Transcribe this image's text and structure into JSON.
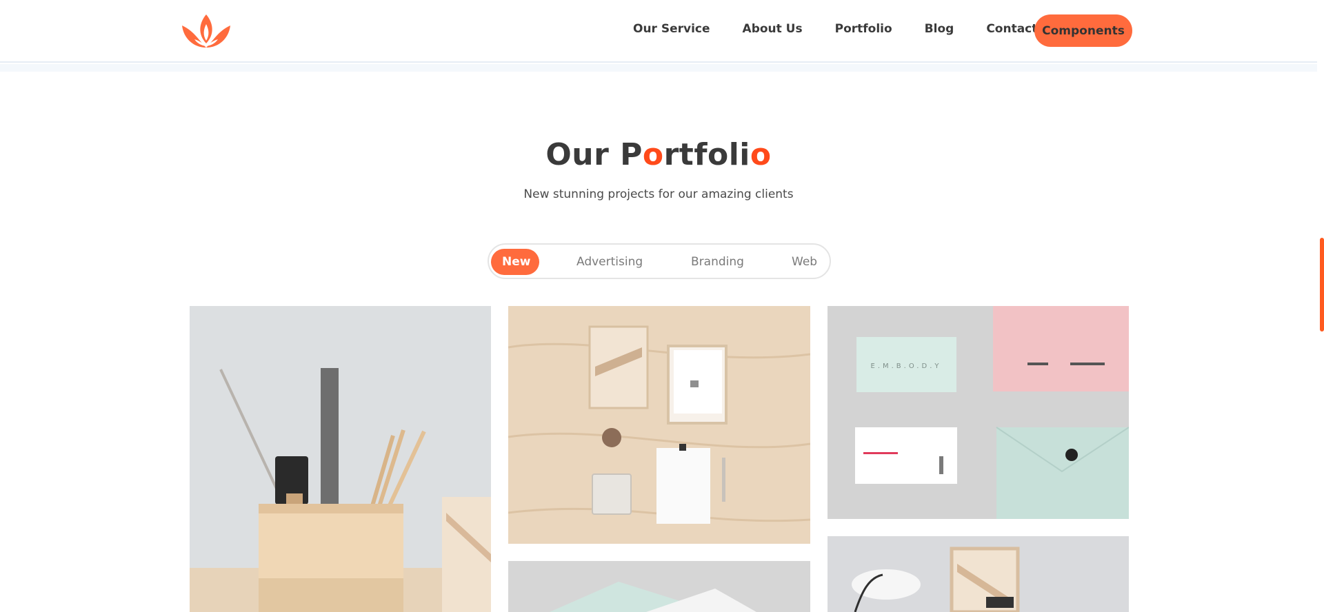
{
  "header": {
    "nav": [
      "Our Service",
      "About Us",
      "Portfolio",
      "Blog",
      "Contact"
    ],
    "cta_label": "Components",
    "brand_color": "#ff6b3d"
  },
  "section": {
    "title_parts": [
      "Our P",
      "o",
      "rtfoli",
      "o"
    ],
    "subtitle": "New stunning projects for our amazing clients"
  },
  "filters": [
    "New",
    "Advertising",
    "Branding",
    "Web"
  ],
  "active_filter": "New",
  "gallery": [
    {
      "name": "pencil-holder-photo"
    },
    {
      "name": "plywood-stationery-photo"
    },
    {
      "name": "business-cards-photo"
    },
    {
      "name": "mint-card-photo"
    },
    {
      "name": "desk-lamp-photo"
    }
  ]
}
